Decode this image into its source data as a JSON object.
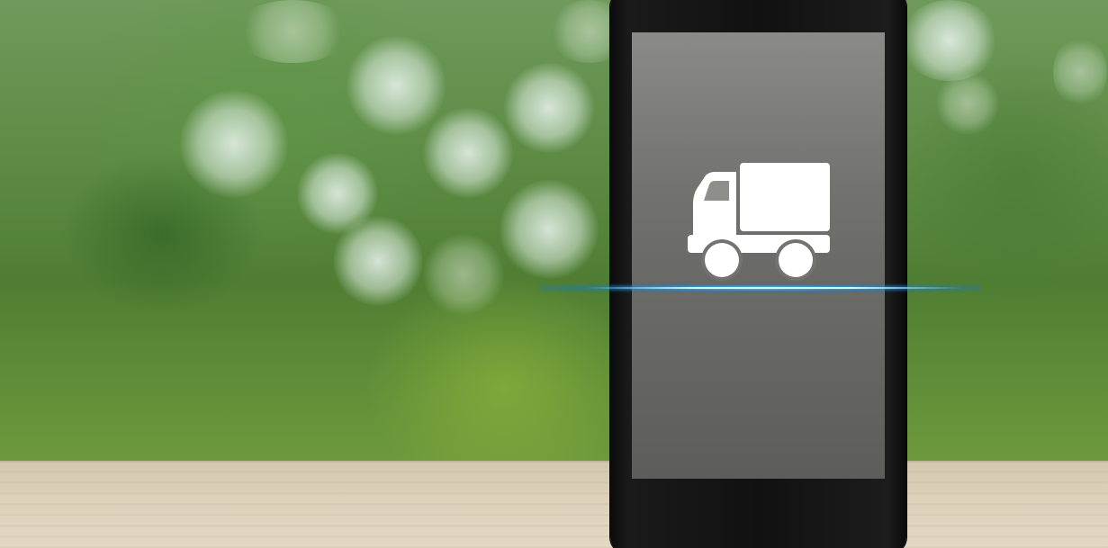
{
  "scene": {
    "subject": "smartphone-with-truck-icon",
    "background": "blurred-green-foliage",
    "surface": "wooden-table"
  },
  "icons": {
    "truck": "truck-icon"
  },
  "colors": {
    "foliage": "#5f8d47",
    "table": "#ddd1ba",
    "phone_body": "#111111",
    "screen": "#72726f",
    "scan_line": "#28aae6",
    "icon": "#ffffff"
  }
}
